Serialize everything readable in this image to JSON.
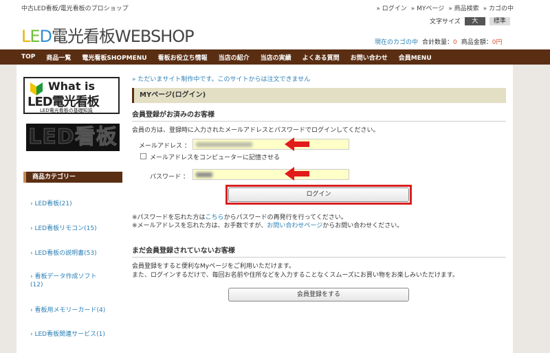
{
  "header": {
    "tagline": "中古LED看板/電光看板のプロショップ",
    "logo": {
      "l": "L",
      "e": "E",
      "d": "D",
      "rest": "電光看板WEBSHOP"
    },
    "toplinks": [
      "» ログイン",
      "» MYページ",
      "» 商品検索",
      "» カゴの中"
    ],
    "font_size_label": "文字サイズ",
    "font_large": "大",
    "font_standard": "標準",
    "cart_link": "現在のカゴの中",
    "total_qty_label": "合計数量：",
    "total_qty_value": "0",
    "total_price_label": "商品金額：",
    "total_price_value": "0円"
  },
  "nav": [
    "TOP",
    "商品一覧",
    "電光看板SHOPMENU",
    "看板お役立ち情報",
    "当店の紹介",
    "当店の実績",
    "よくある質問",
    "お問い合わせ",
    "会員MENU"
  ],
  "sidebar": {
    "banner1": {
      "what": "What is",
      "big": "LED電光看板",
      "sub": "LED電光看板の基礎知識"
    },
    "banner2": "LED看板",
    "category_title": "商品カテゴリー",
    "categories": [
      "LED看板(21)",
      "LED看板リモコン(15)",
      "LED看板の説明書(53)",
      "看板データ作成ソフト\n(12)",
      "看板用メモリーカード(4)",
      "LED看板関連サービス(1)"
    ]
  },
  "main": {
    "notice": "» ただいまサイト制作中です。このサイトからは注文できません",
    "page_title": "MYページ(ログイン)",
    "member_heading": "会員登録がお済みのお客様",
    "member_desc": "会員の方は、登録時に入力されたメールアドレスとパスワードでログインしてください。",
    "email_label": "メールアドレス ：",
    "remember_label": "メールアドレスをコンピューターに記憶させる",
    "password_label": "パスワード ：",
    "login_button": "ログイン",
    "forgot_pw_1": "※パスワードを忘れた方は",
    "forgot_pw_link": "こちら",
    "forgot_pw_2": "からパスワードの再発行を行ってください。",
    "forgot_mail_1": "※メールアドレスを忘れた方は、お手数ですが、",
    "forgot_mail_link": "お問い合わせページ",
    "forgot_mail_2": "からお問い合わせください。",
    "guest_heading": "まだ会員登録されていないお客様",
    "guest_desc_1": "会員登録をすると便利なMyページをご利用いただけます。",
    "guest_desc_2": "また、ログインするだけで、毎回お名前や住所などを入力することなくスムーズにお買い物をお楽しみいただけます。",
    "register_button": "会員登録をする"
  },
  "colors": {
    "nav_bg": "#5a2e13",
    "link": "#2a7fb5",
    "highlight": "#d91f1f",
    "input_bg": "#ffffc8"
  }
}
